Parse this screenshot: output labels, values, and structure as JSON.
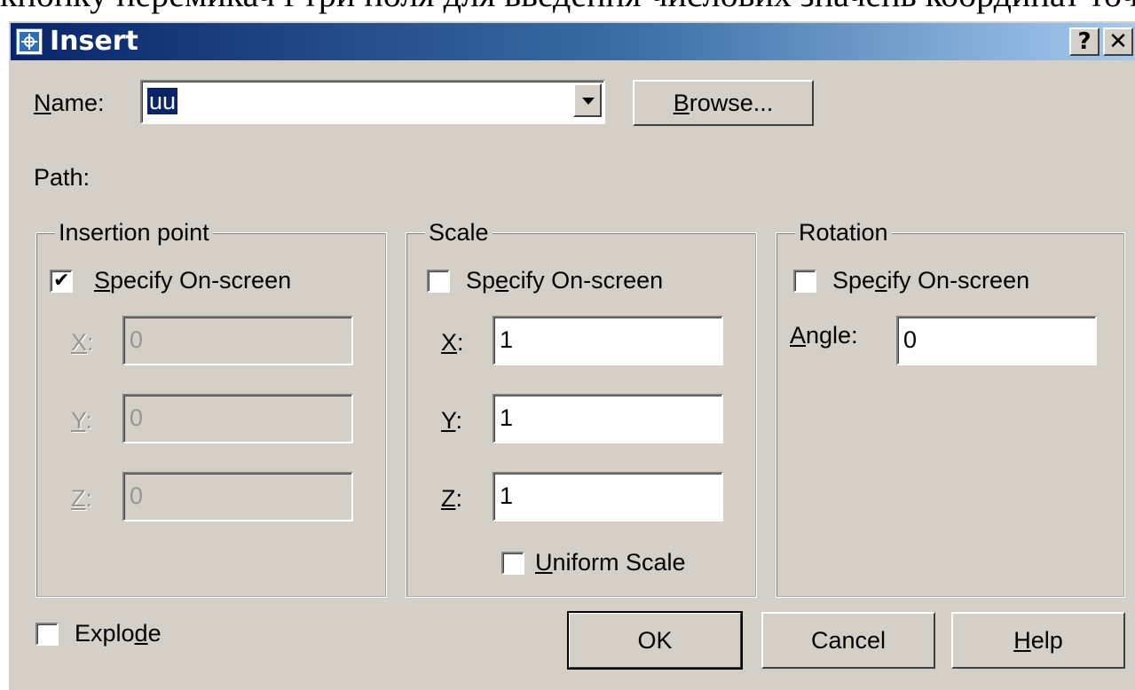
{
  "caption_text": "кнопку перемикач і три поля для введення числових значень координат точки.",
  "window": {
    "title": "Insert",
    "help_button": "?",
    "close_button": "✕"
  },
  "name_row": {
    "label": "Name:",
    "value": "uu",
    "browse_label": "Browse..."
  },
  "path_label": "Path:",
  "insertion_point": {
    "title": "Insertion point",
    "specify_label": "Specify On-screen",
    "specify_checked": true,
    "x_label": "X:",
    "x_value": "0",
    "y_label": "Y:",
    "y_value": "0",
    "z_label": "Z:",
    "z_value": "0"
  },
  "scale": {
    "title": "Scale",
    "specify_label": "Specify On-screen",
    "specify_checked": false,
    "x_label": "X:",
    "x_value": "1",
    "y_label": "Y:",
    "y_value": "1",
    "z_label": "Z:",
    "z_value": "1",
    "uniform_label": "Uniform Scale",
    "uniform_checked": false
  },
  "rotation": {
    "title": "Rotation",
    "specify_label": "Specify On-screen",
    "specify_checked": false,
    "angle_label": "Angle:",
    "angle_value": "0"
  },
  "explode": {
    "label": "Explode",
    "checked": false
  },
  "buttons": {
    "ok": "OK",
    "cancel": "Cancel",
    "help": "Help"
  },
  "colors": {
    "face": "#d4d0c8",
    "title_start": "#0a246a",
    "title_end": "#a6caf0",
    "selection": "#0a246a"
  },
  "icons": {
    "check": "✔",
    "app_icon": "insert-block-icon"
  }
}
